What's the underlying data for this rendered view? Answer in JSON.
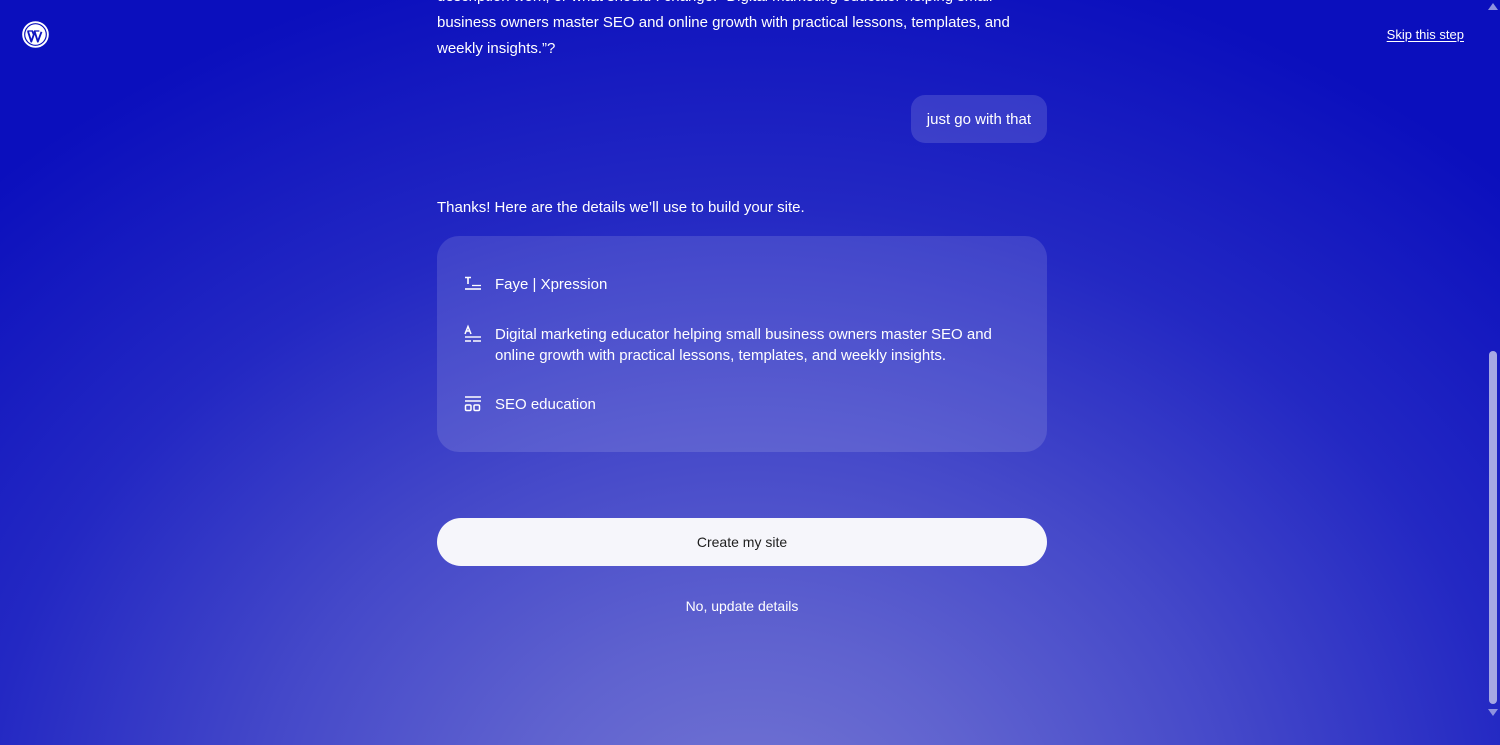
{
  "header": {
    "logo_icon": "wordpress-logo-icon",
    "skip_label": "Skip this step"
  },
  "chat": {
    "intro_text": "description work, or what should I change: “Digital marketing educator helping small business owners master SEO and online growth with practical lessons, templates, and weekly insights.”?",
    "user_reply": "just go with that",
    "thanks_text": "Thanks! Here are the details we’ll use to build your site."
  },
  "details": {
    "items": [
      {
        "icon": "site-title-icon",
        "text": "Faye | Xpression"
      },
      {
        "icon": "site-tagline-icon",
        "text": "Digital marketing educator helping small business owners master SEO and online growth with practical lessons, templates, and weekly insights."
      },
      {
        "icon": "category-icon",
        "text": "SEO education"
      }
    ]
  },
  "actions": {
    "create_label": "Create my site",
    "update_label": "No, update details"
  },
  "colors": {
    "background_top": "#0b0fbd",
    "background_bottom": "#7476d3",
    "button_bg": "#f6f6fb",
    "button_text": "#1e1e1e"
  }
}
